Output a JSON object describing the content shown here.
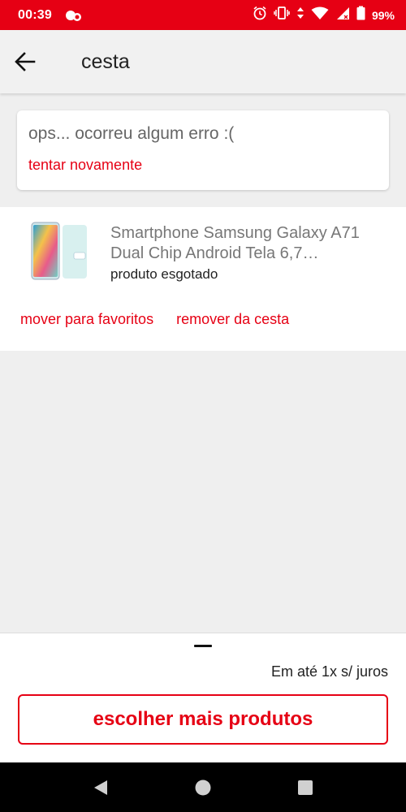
{
  "status_bar": {
    "time": "00:39",
    "battery": "99%",
    "icons": [
      "notification-icon",
      "alarm-icon",
      "vibrate-icon",
      "data-transfer-icon",
      "wifi-icon",
      "signal-icon",
      "battery-icon"
    ]
  },
  "app_bar": {
    "title": "cesta",
    "back_icon": "arrow-left-icon"
  },
  "error": {
    "message": "ops... ocorreu algum erro :(",
    "retry_label": "tentar novamente"
  },
  "product": {
    "name": "Smartphone Samsung Galaxy A71 Dual Chip Android Tela 6,7 polegadas",
    "status": "produto esgotado",
    "move_to_favorites_label": "mover para favoritos",
    "remove_label": "remover da cesta"
  },
  "bottom_sheet": {
    "installment": "Em até 1x s/ juros",
    "button_label": "escolher mais produtos"
  },
  "colors": {
    "accent": "#e60014",
    "background": "#efefef"
  }
}
